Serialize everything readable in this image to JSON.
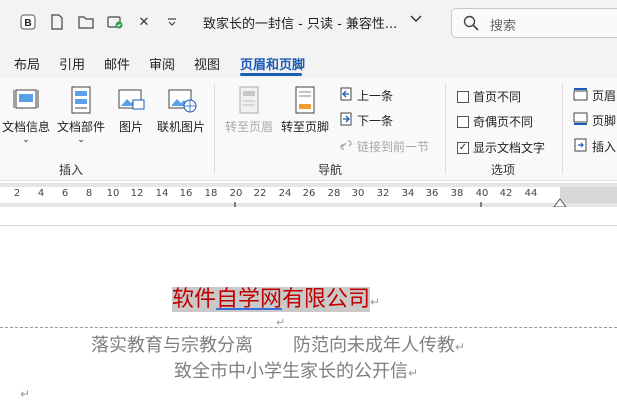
{
  "titlebar": {
    "doc_title": "致家长的一封信 - 只读 - 兼容性...",
    "icons": [
      "logo-icon",
      "file-icon",
      "open-folder-icon",
      "cloud-sync-icon",
      "close-doc-icon",
      "more-icon",
      "chevron-down-icon"
    ],
    "search_placeholder": "搜索"
  },
  "tabs": [
    "布局",
    "引用",
    "邮件",
    "审阅",
    "视图",
    "页眉和页脚"
  ],
  "active_tab": "页眉和页脚",
  "ribbon": {
    "insert_group": {
      "label": "插入",
      "buttons": [
        "文档信息",
        "文档部件",
        "图片",
        "联机图片"
      ]
    },
    "navigation_group": {
      "label": "导航",
      "goto_header": "转至页眉",
      "goto_footer": "转至页脚",
      "prev": "上一条",
      "next": "下一条",
      "link_prev": "链接到前一节"
    },
    "options_group": {
      "label": "选项",
      "diff_first": "首页不同",
      "diff_odd_even": "奇偶页不同",
      "show_doc_text": "显示文档文字",
      "show_doc_text_checked": true
    },
    "position_group": {
      "header_pos": "页眉",
      "footer_pos": "页脚",
      "insert_tab": "插入"
    }
  },
  "ruler": {
    "ticks": [
      "2",
      "4",
      "6",
      "8",
      "10",
      "12",
      "14",
      "16",
      "18",
      "20",
      "22",
      "24",
      "26",
      "28",
      "30",
      "32",
      "34",
      "36",
      "38",
      "40",
      "42",
      "44"
    ]
  },
  "document": {
    "header_part1": "软件",
    "header_part2": "自学网",
    "header_part3": "有限公司",
    "line1_a": "落实教育与宗教分离",
    "line1_b": "防范向未成年人传教",
    "line2": "致全市中小学生家长的公开信",
    "para_mark": "↵"
  },
  "colors": {
    "accent": "#1b5cb6",
    "header_text": "#c00000",
    "body_text": "#7f7f7f"
  }
}
